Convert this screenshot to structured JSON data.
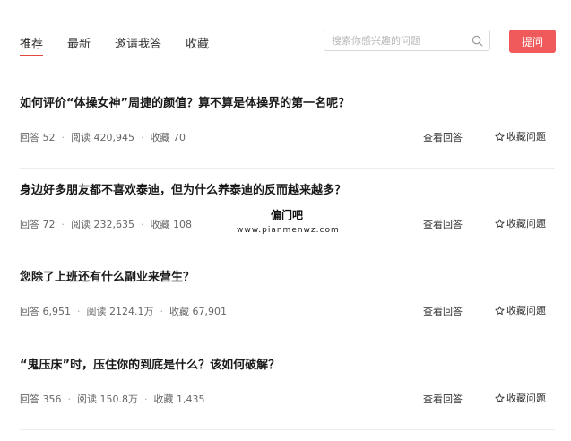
{
  "nav": {
    "tabs": [
      {
        "label": "推荐",
        "active": true
      },
      {
        "label": "最新",
        "active": false
      },
      {
        "label": "邀请我答",
        "active": false
      },
      {
        "label": "收藏",
        "active": false
      }
    ]
  },
  "search": {
    "placeholder": "搜索你感兴趣的问题",
    "value": "",
    "icon": "search-icon"
  },
  "ask_button": {
    "label": "提问",
    "color": "#f05a5a"
  },
  "accent_color": "#e2483d",
  "questions": [
    {
      "title": "如何评价“体操女神”周捷的颜值？算不算是体操界的第一名呢？",
      "answers": "回答 52",
      "reads": "阅读 420,945",
      "favorites": "收藏 70",
      "view_label": "查看回答",
      "collect_label": "收藏问题"
    },
    {
      "title": "身边好多朋友都不喜欢泰迪，但为什么养泰迪的反而越来越多？",
      "answers": "回答 72",
      "reads": "阅读 232,635",
      "favorites": "收藏 108",
      "view_label": "查看回答",
      "collect_label": "收藏问题"
    },
    {
      "title": "您除了上班还有什么副业来营生？",
      "answers": "回答 6,951",
      "reads": "阅读 2124.1万",
      "favorites": "收藏 67,901",
      "view_label": "查看回答",
      "collect_label": "收藏问题"
    },
    {
      "title": "“鬼压床”时，压住你的到底是什么？该如何破解？",
      "answers": "回答 356",
      "reads": "阅读 150.8万",
      "favorites": "收藏 1,435",
      "view_label": "查看回答",
      "collect_label": "收藏问题"
    }
  ],
  "watermark": {
    "title": "偏门吧",
    "url": "www.pianmenwz.com"
  }
}
